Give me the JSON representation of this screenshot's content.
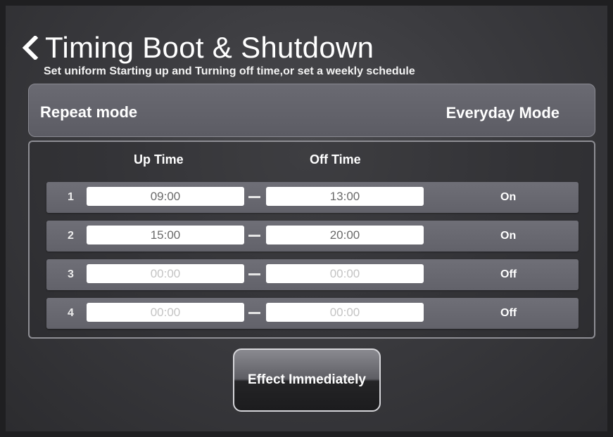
{
  "header": {
    "back_icon": "chevron-left-icon",
    "title": "Timing Boot & Shutdown",
    "subtitle": "Set uniform Starting up and Turning off time,or set a weekly schedule"
  },
  "repeat": {
    "label": "Repeat mode",
    "value": "Everyday Mode"
  },
  "schedule": {
    "columns": {
      "up": "Up Time",
      "off": "Off Time"
    },
    "rows": [
      {
        "index": "1",
        "up": "09:00",
        "off": "13:00",
        "status": "On"
      },
      {
        "index": "2",
        "up": "15:00",
        "off": "20:00",
        "status": "On"
      },
      {
        "index": "3",
        "up": "00:00",
        "off": "00:00",
        "status": "Off"
      },
      {
        "index": "4",
        "up": "00:00",
        "off": "00:00",
        "status": "Off"
      }
    ]
  },
  "actions": {
    "effect_label": "Effect Immediately"
  },
  "colors": {
    "background": "#3b3b3f",
    "row": "#6a6a72",
    "field": "#ffffff",
    "text": "#ffffff"
  }
}
